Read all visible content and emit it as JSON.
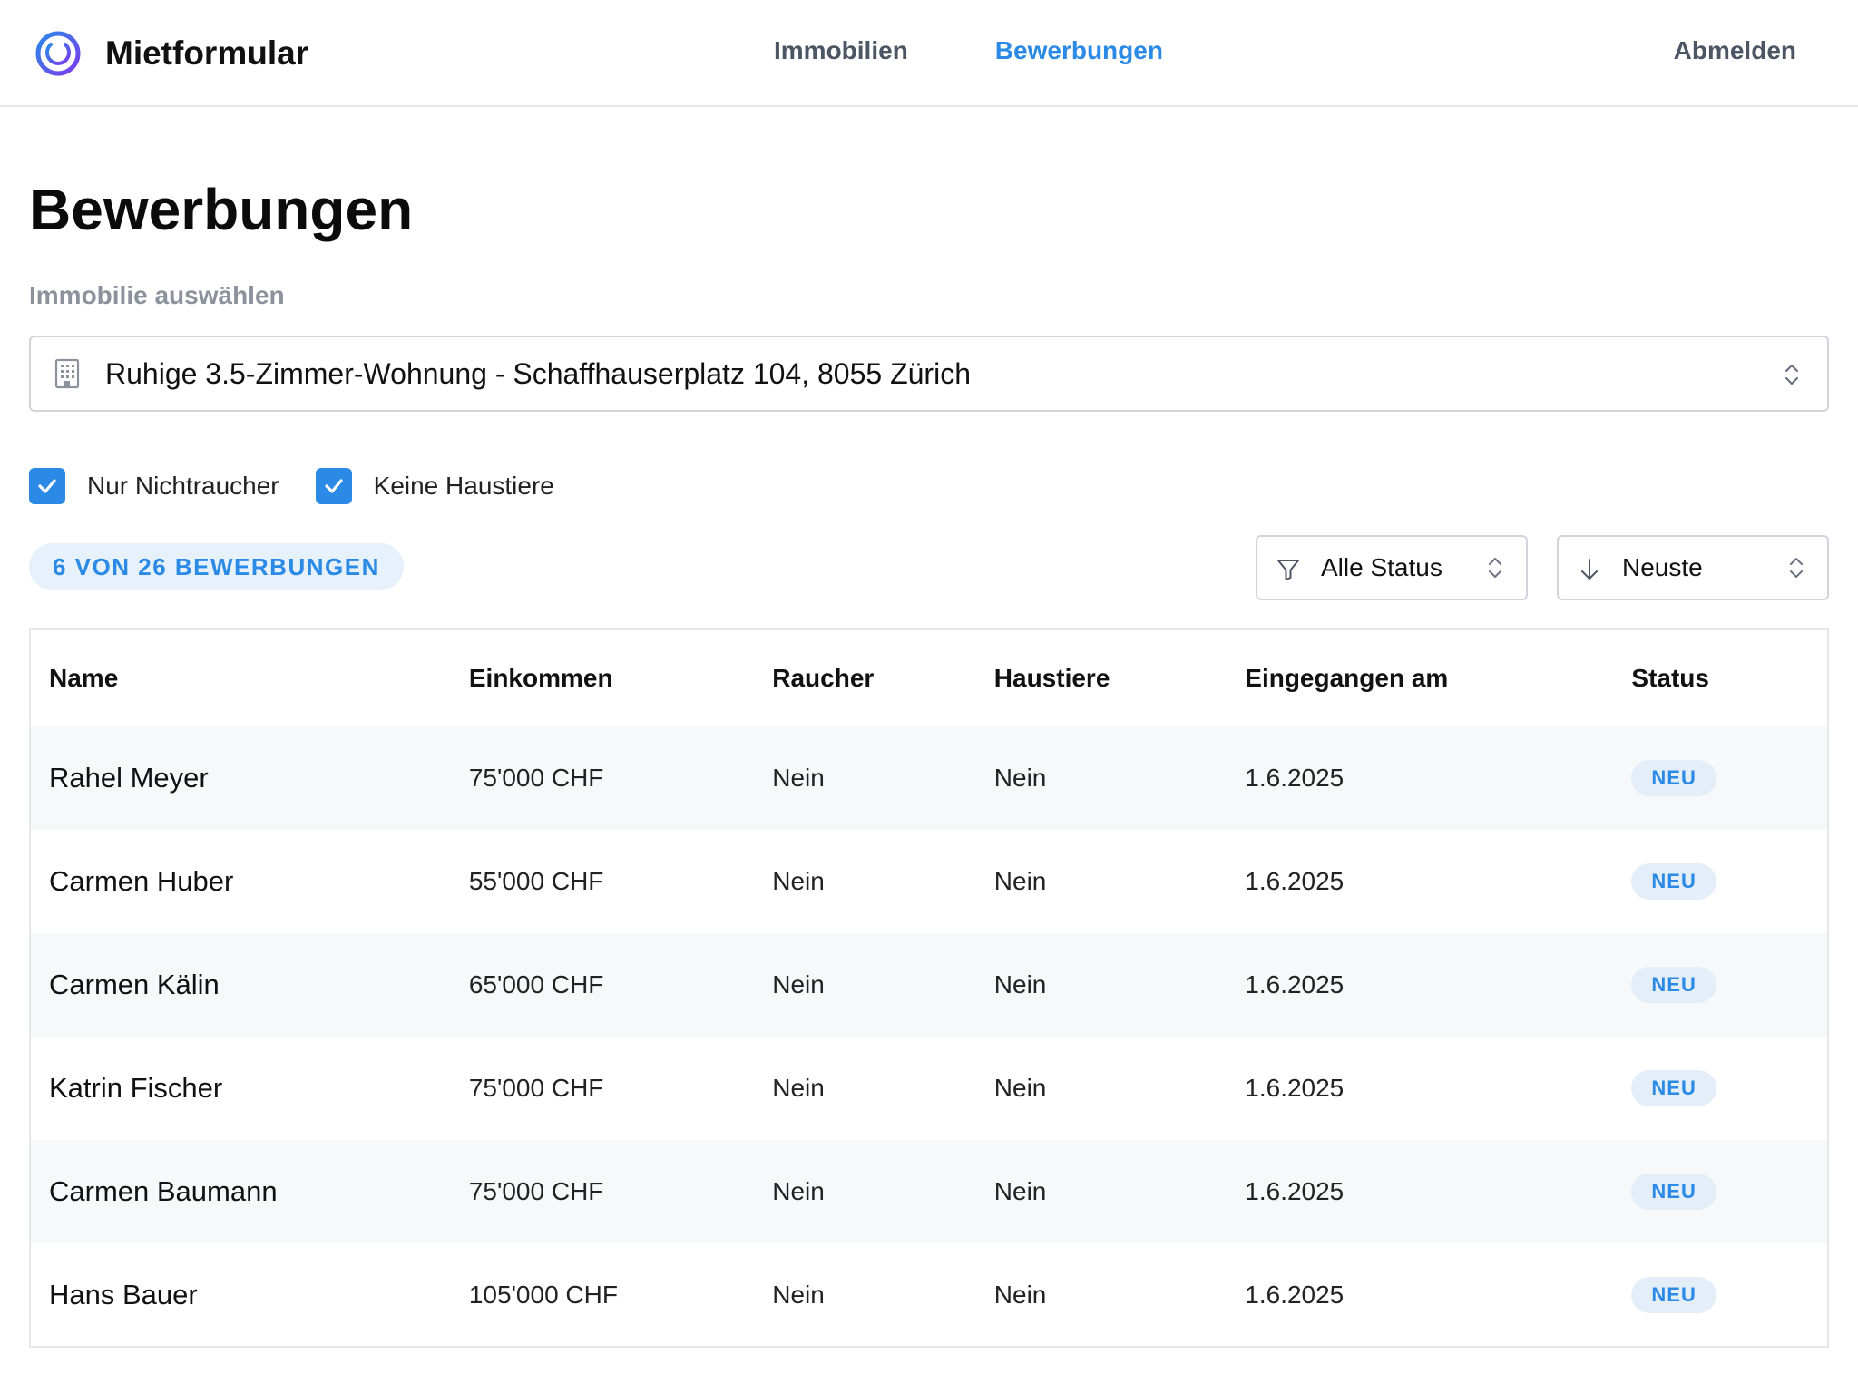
{
  "header": {
    "app_name": "Mietformular",
    "nav": [
      {
        "label": "Immobilien",
        "active": false
      },
      {
        "label": "Bewerbungen",
        "active": true
      }
    ],
    "logout_label": "Abmelden"
  },
  "page": {
    "title": "Bewerbungen",
    "property_label": "Immobilie auswählen",
    "property_value": "Ruhige 3.5-Zimmer-Wohnung - Schaffhauserplatz 104, 8055 Zürich",
    "filters": [
      {
        "label": "Nur Nichtraucher",
        "checked": true
      },
      {
        "label": "Keine Haustiere",
        "checked": true
      }
    ],
    "count_label": "6 VON 26 BEWERBUNGEN",
    "status_filter": "Alle Status",
    "sort": "Neuste"
  },
  "table": {
    "columns": [
      "Name",
      "Einkommen",
      "Raucher",
      "Haustiere",
      "Eingegangen am",
      "Status"
    ],
    "rows": [
      {
        "name": "Rahel Meyer",
        "income": "75'000 CHF",
        "smoker": "Nein",
        "pets": "Nein",
        "date": "1.6.2025",
        "status": "NEU"
      },
      {
        "name": "Carmen Huber",
        "income": "55'000 CHF",
        "smoker": "Nein",
        "pets": "Nein",
        "date": "1.6.2025",
        "status": "NEU"
      },
      {
        "name": "Carmen Kälin",
        "income": "65'000 CHF",
        "smoker": "Nein",
        "pets": "Nein",
        "date": "1.6.2025",
        "status": "NEU"
      },
      {
        "name": "Katrin Fischer",
        "income": "75'000 CHF",
        "smoker": "Nein",
        "pets": "Nein",
        "date": "1.6.2025",
        "status": "NEU"
      },
      {
        "name": "Carmen Baumann",
        "income": "75'000 CHF",
        "smoker": "Nein",
        "pets": "Nein",
        "date": "1.6.2025",
        "status": "NEU"
      },
      {
        "name": "Hans Bauer",
        "income": "105'000 CHF",
        "smoker": "Nein",
        "pets": "Nein",
        "date": "1.6.2025",
        "status": "NEU"
      }
    ]
  },
  "colors": {
    "accent": "#2b8ae6",
    "badge_bg": "#e4eef8",
    "row_stripe": "#f6f8fa"
  },
  "icons": [
    "logo-icon",
    "building-icon",
    "chevron-updown-icon",
    "filter-icon",
    "arrow-down-icon",
    "checkmark-icon"
  ]
}
